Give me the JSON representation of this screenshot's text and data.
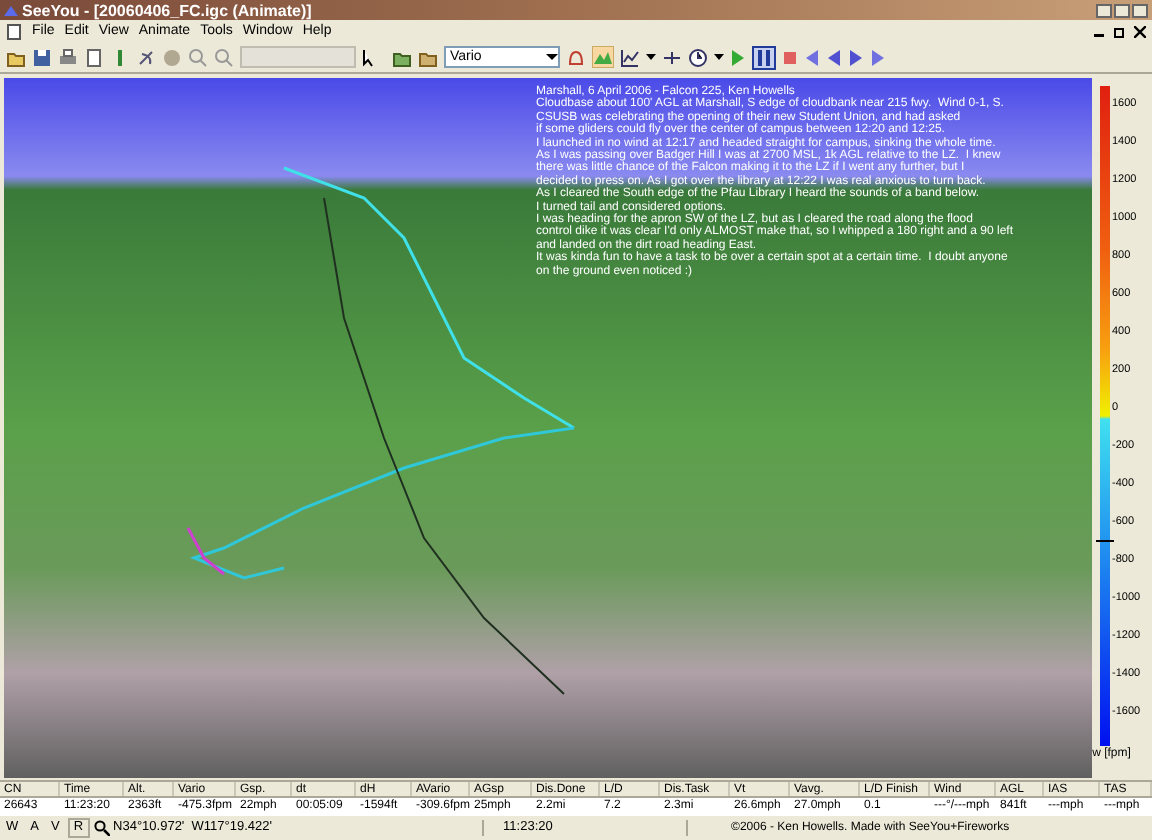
{
  "window": {
    "title": "SeeYou - [20060406_FC.igc (Animate)]"
  },
  "menu": [
    "File",
    "Edit",
    "View",
    "Animate",
    "Tools",
    "Window",
    "Help"
  ],
  "toolbar": {
    "parameter_select": "Vario",
    "paused": true
  },
  "notes": [
    "Marshall, 6 April 2006 - Falcon 225, Ken Howells",
    "Cloudbase about 100' AGL at Marshall, S edge of cloudbank near 215 fwy.  Wind 0-1, S.",
    "CSUSB was celebrating the opening of their new Student Union, and had asked",
    "if some gliders could fly over the center of campus between 12:20 and 12:25.",
    "I launched in no wind at 12:17 and headed straight for campus, sinking the whole time.",
    "As I was passing over Badger Hill I was at 2700 MSL, 1k AGL relative to the LZ.  I knew",
    "there was little chance of the Falcon making it to the LZ if I went any further, but I",
    "decided to press on. As I got over the library at 12:22 I was real anxious to turn back.",
    "As I cleared the South edge of the Pfau Library I heard the sounds of a band below.",
    "I turned tail and considered options.",
    "I was heading for the apron SW of the LZ, but as I cleared the road along the flood",
    "control dike it was clear I'd only ALMOST make that, so I whipped a 180 right and a 90 left",
    "and landed on the dirt road heading East.",
    "It was kinda fun to have a task to be over a certain spot at a certain time.  I doubt anyone",
    "on the ground even noticed :)"
  ],
  "legend": {
    "labels": [
      "1600",
      "1400",
      "1200",
      "1000",
      "800",
      "600",
      "400",
      "200",
      "0",
      "-200",
      "-400",
      "-600",
      "-800",
      "-1000",
      "-1200",
      "-1400",
      "-1600"
    ],
    "unit": "w [fpm]"
  },
  "table": {
    "columns": [
      "CN",
      "Time",
      "Alt.",
      "Vario",
      "Gsp.",
      "dt",
      "dH",
      "AVario",
      "AGsp",
      "Dis.Done",
      "L/D",
      "Dis.Task",
      "Vt",
      "Vavg.",
      "L/D Finish",
      "Wind",
      "AGL",
      "IAS",
      "TAS"
    ],
    "row": [
      "26643",
      "11:23:20",
      "2363ft",
      "-475.3fpm",
      "22mph",
      "00:05:09",
      "-1594ft",
      "-309.6fpm",
      "25mph",
      "2.2mi",
      "7.2",
      "2.3mi",
      "26.6mph",
      "27.0mph",
      "0.1",
      "---°/---mph",
      "841ft",
      "---mph",
      "---mph"
    ]
  },
  "status_bar": {
    "buttons": [
      "W",
      "A",
      "V"
    ],
    "r": "R",
    "coordinates": "N34°10.972'  W117°19.422'",
    "time": "11:23:20",
    "credit": "©2006 - Ken Howells. Made with SeeYou+Fireworks"
  }
}
